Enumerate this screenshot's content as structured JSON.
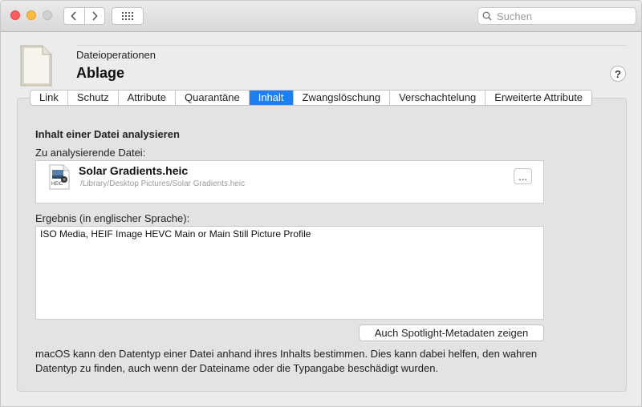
{
  "toolbar": {
    "back_icon": "chevron-left-icon",
    "forward_icon": "chevron-right-icon",
    "grid_icon": "grid-icon",
    "search_placeholder": "Suchen"
  },
  "header": {
    "subtitle": "Dateioperationen",
    "title": "Ablage",
    "help_label": "?"
  },
  "tabs": [
    {
      "label": "Link",
      "active": false
    },
    {
      "label": "Schutz",
      "active": false
    },
    {
      "label": "Attribute",
      "active": false
    },
    {
      "label": "Quarantäne",
      "active": false
    },
    {
      "label": "Inhalt",
      "active": true
    },
    {
      "label": "Zwangslöschung",
      "active": false
    },
    {
      "label": "Verschachtelung",
      "active": false
    },
    {
      "label": "Erweiterte Attribute",
      "active": false
    }
  ],
  "content": {
    "section_title": "Inhalt einer Datei analysieren",
    "file_label": "Zu analysierende Datei:",
    "file": {
      "name": "Solar Gradients.heic",
      "path": "/Library/Desktop Pictures/Solar Gradients.heic",
      "icon_label": "HEIC",
      "choose_label": "..."
    },
    "result_label": "Ergebnis (in englischer Sprache):",
    "result_text": "ISO Media, HEIF Image HEVC Main or Main Still Picture Profile",
    "spotlight_button": "Auch Spotlight-Metadaten zeigen",
    "description": "macOS kann den Datentyp einer Datei anhand ihres Inhalts bestimmen. Dies kann dabei helfen, den wahren Datentyp zu finden, auch wenn der Dateiname oder die Typangabe beschädigt wurden."
  },
  "colors": {
    "accent": "#1c7ff4",
    "close": "#fc605c",
    "minimize": "#fdbc40",
    "zoom_disabled": "#d0d0d0"
  }
}
